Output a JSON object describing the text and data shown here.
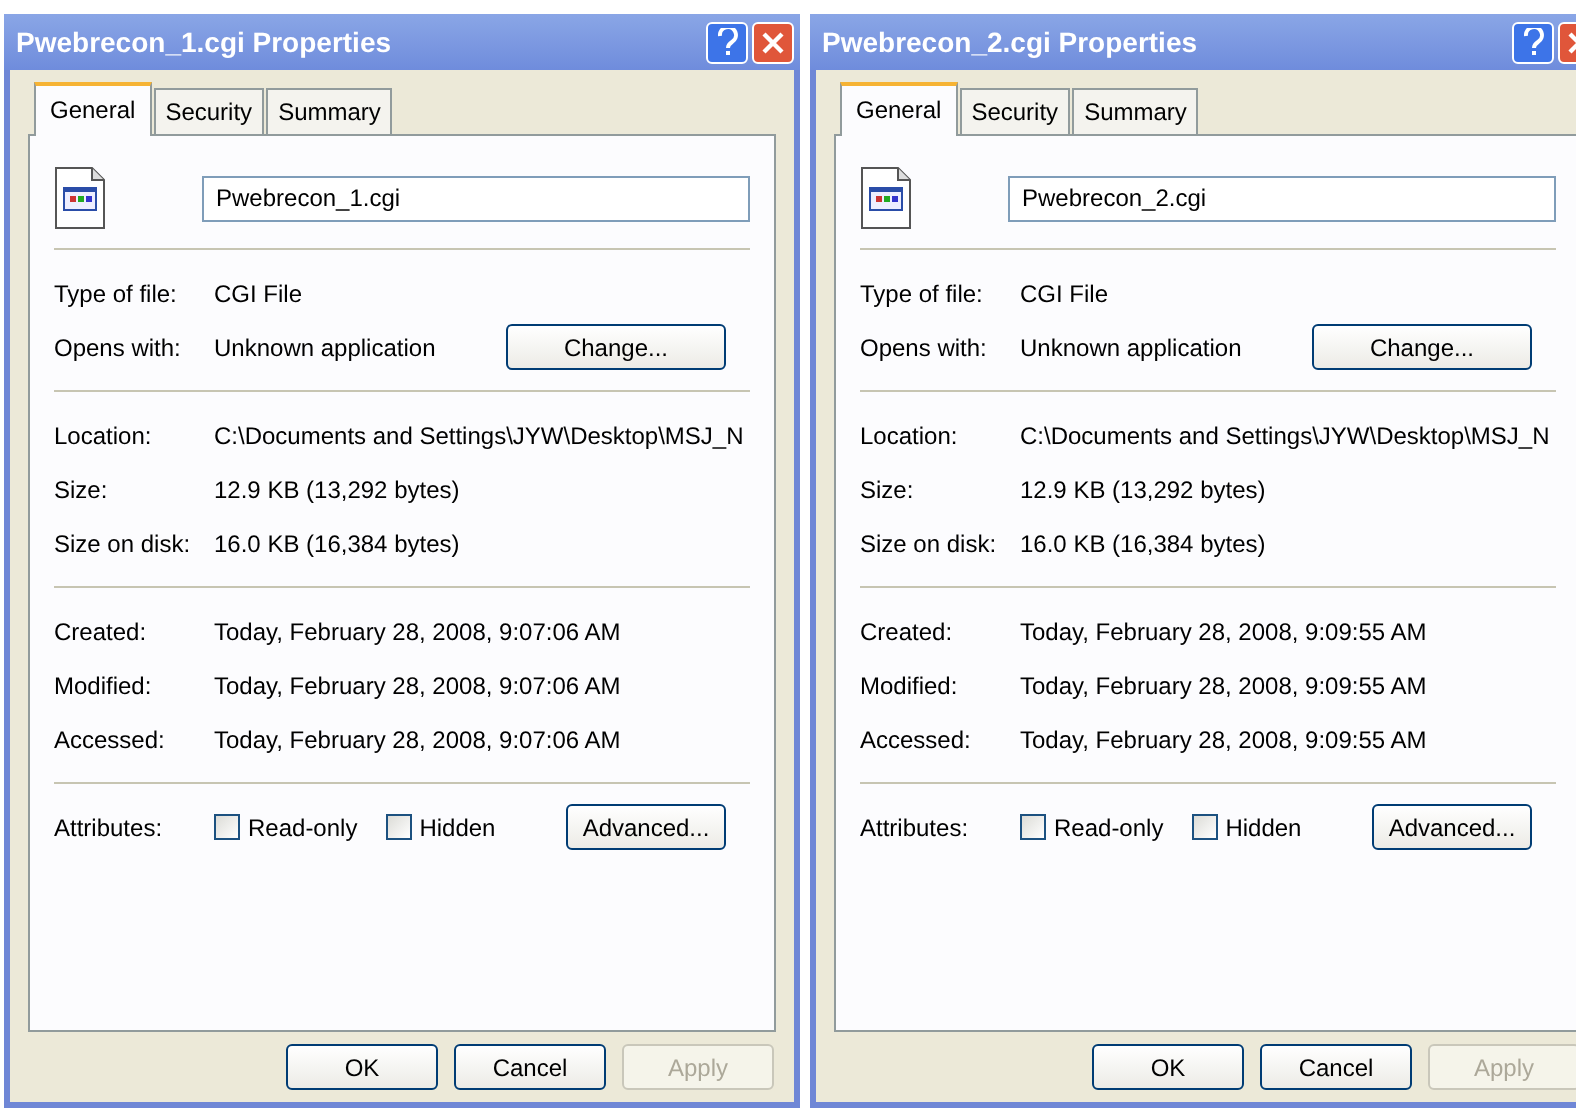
{
  "windows": [
    {
      "title": "Pwebrecon_1.cgi Properties",
      "tabs": [
        {
          "label": "General",
          "selected": true
        },
        {
          "label": "Security",
          "selected": false
        },
        {
          "label": "Summary",
          "selected": false
        }
      ],
      "file_name": "Pwebrecon_1.cgi",
      "groups": [
        [
          {
            "label": "Type of file:",
            "value": "CGI File"
          },
          {
            "label": "Opens with:",
            "value": "Unknown application",
            "button": "Change..."
          }
        ],
        [
          {
            "label": "Location:",
            "value": "C:\\Documents and Settings\\JYW\\Desktop\\MSJ_N"
          },
          {
            "label": "Size:",
            "value": "12.9 KB (13,292 bytes)"
          },
          {
            "label": "Size on disk:",
            "value": "16.0 KB (16,384 bytes)"
          }
        ],
        [
          {
            "label": "Created:",
            "value": "Today, February 28, 2008, 9:07:06 AM"
          },
          {
            "label": "Modified:",
            "value": "Today, February 28, 2008, 9:07:06 AM"
          },
          {
            "label": "Accessed:",
            "value": "Today, February 28, 2008, 9:07:06 AM"
          }
        ]
      ],
      "attributes": {
        "label": "Attributes:",
        "checkboxes": [
          {
            "label": "Read-only",
            "checked": false
          },
          {
            "label": "Hidden",
            "checked": false
          }
        ],
        "button": "Advanced..."
      },
      "buttons": [
        {
          "label": "OK",
          "disabled": false
        },
        {
          "label": "Cancel",
          "disabled": false
        },
        {
          "label": "Apply",
          "disabled": true
        }
      ]
    },
    {
      "title": "Pwebrecon_2.cgi Properties",
      "tabs": [
        {
          "label": "General",
          "selected": true
        },
        {
          "label": "Security",
          "selected": false
        },
        {
          "label": "Summary",
          "selected": false
        }
      ],
      "file_name": "Pwebrecon_2.cgi",
      "groups": [
        [
          {
            "label": "Type of file:",
            "value": "CGI File"
          },
          {
            "label": "Opens with:",
            "value": "Unknown application",
            "button": "Change..."
          }
        ],
        [
          {
            "label": "Location:",
            "value": "C:\\Documents and Settings\\JYW\\Desktop\\MSJ_N"
          },
          {
            "label": "Size:",
            "value": "12.9 KB (13,292 bytes)"
          },
          {
            "label": "Size on disk:",
            "value": "16.0 KB (16,384 bytes)"
          }
        ],
        [
          {
            "label": "Created:",
            "value": "Today, February 28, 2008, 9:09:55 AM"
          },
          {
            "label": "Modified:",
            "value": "Today, February 28, 2008, 9:09:55 AM"
          },
          {
            "label": "Accessed:",
            "value": "Today, February 28, 2008, 9:09:55 AM"
          }
        ]
      ],
      "attributes": {
        "label": "Attributes:",
        "checkboxes": [
          {
            "label": "Read-only",
            "checked": false
          },
          {
            "label": "Hidden",
            "checked": false
          }
        ],
        "button": "Advanced..."
      },
      "buttons": [
        {
          "label": "OK",
          "disabled": false
        },
        {
          "label": "Cancel",
          "disabled": false
        },
        {
          "label": "Apply",
          "disabled": true
        }
      ]
    }
  ]
}
